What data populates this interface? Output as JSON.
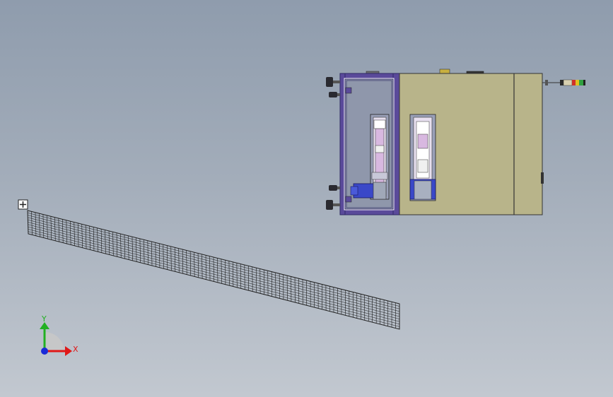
{
  "viewport": {
    "type": "cad-3d-graphics-area"
  },
  "triad": {
    "x_label": "X",
    "y_label": "Y",
    "colors": {
      "x": "#e01818",
      "y": "#22b022",
      "z": "#1a2ad8"
    }
  },
  "colors": {
    "machine_frame": "#5a4a9a",
    "machine_body": "#b8b48a",
    "rail": "#d8c8e8",
    "motor": "#3a48c8",
    "mesh_line": "#222222"
  },
  "icons": {
    "origin": "origin-marker-icon",
    "stack_light": "stack-light-icon"
  }
}
